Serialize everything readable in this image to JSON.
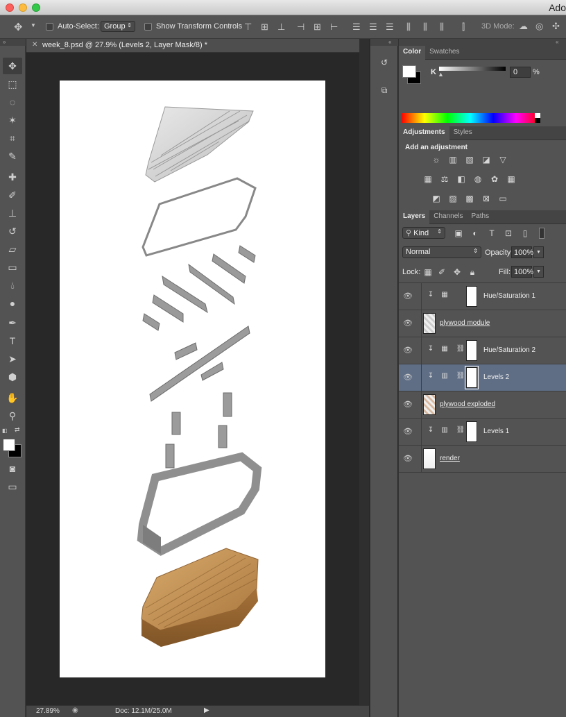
{
  "app": {
    "title_partial": "Ado"
  },
  "options_bar": {
    "auto_select_label": "Auto-Select:",
    "auto_select_value": "Group",
    "show_transform_label": "Show Transform Controls",
    "mode_3d_label": "3D Mode:"
  },
  "document": {
    "tab_title": "week_8.psd @ 27.9% (Levels 2, Layer Mask/8) *",
    "zoom": "27.89%",
    "doc_size": "Doc: 12.1M/25.0M"
  },
  "color_panel": {
    "tabs": [
      "Color",
      "Swatches"
    ],
    "channel_label": "K",
    "channel_value": "0",
    "unit": "%"
  },
  "adjustments_panel": {
    "tabs": [
      "Adjustments",
      "Styles"
    ],
    "heading": "Add an adjustment"
  },
  "layers_panel": {
    "tabs": [
      "Layers",
      "Channels",
      "Paths"
    ],
    "filter_kind": "Kind",
    "blend_mode": "Normal",
    "opacity_label": "Opacity:",
    "opacity_value": "100%",
    "lock_label": "Lock:",
    "fill_label": "Fill:",
    "fill_value": "100%",
    "layers": [
      {
        "name": "Hue/Saturation 1",
        "type": "adjustment"
      },
      {
        "name": "plywood module",
        "type": "pixel"
      },
      {
        "name": "Hue/Saturation 2",
        "type": "adjustment"
      },
      {
        "name": "Levels 2",
        "type": "adjustment",
        "selected": true
      },
      {
        "name": "plywood exploded",
        "type": "pixel"
      },
      {
        "name": "Levels 1",
        "type": "adjustment"
      },
      {
        "name": "render",
        "type": "pixel"
      }
    ]
  },
  "colors": {
    "selection": "#5f6e85",
    "panel": "#535353",
    "wood": "#b98a4e"
  }
}
